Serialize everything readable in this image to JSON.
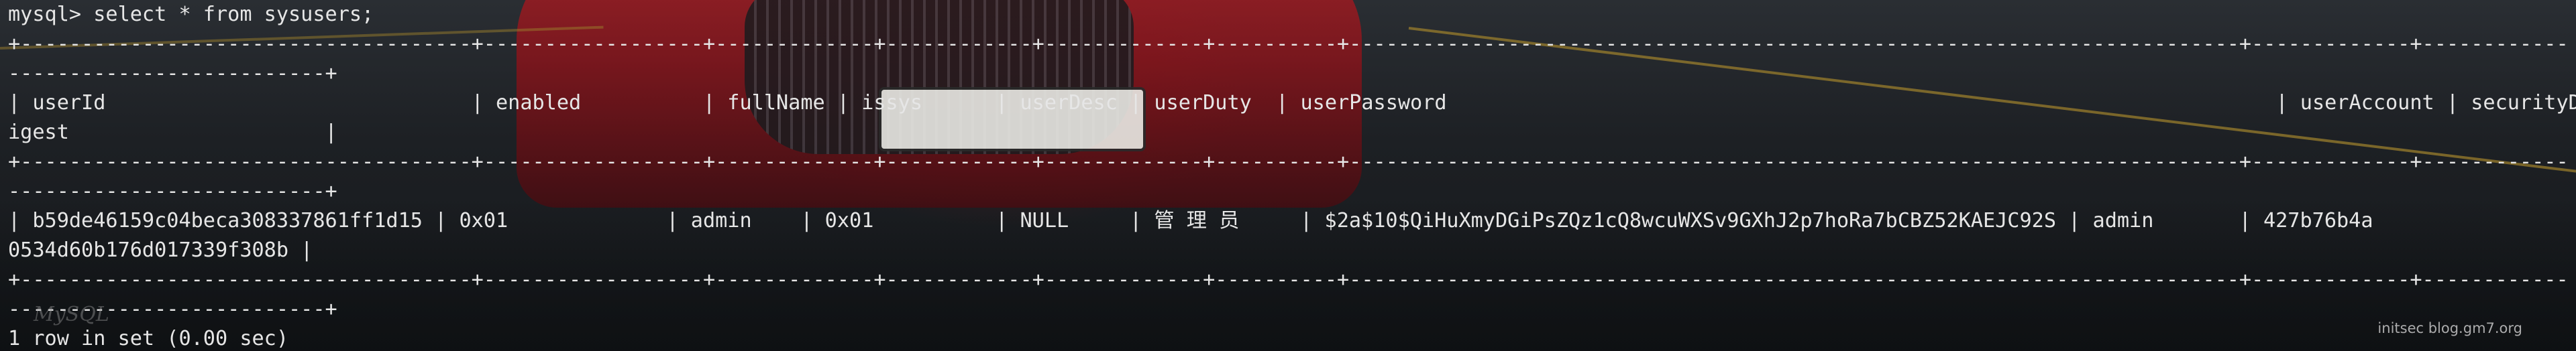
{
  "terminal": {
    "prompt": "mysql> select * from sysusers;",
    "border_1": "+-------------------------------------+------------------+-------------+------------+-------------+----------+-------------------------------------------------------------------------+-------------+------------",
    "border_2": "--------------------------+",
    "header_1": "| userId                              | enabled          | fullName | issys      | userDesc | userDuty  | userPassword                                                                    | userAccount | securityD",
    "header_2": "igest                     |",
    "row_1": "| b59de46159c04beca308337861ff1d15 | 0x01             | admin    | 0x01          | NULL     | 管 理 员     | $2a$10$QiHuXmyDGiPsZQz1cQ8wcuWXSv9GXhJ2p7hoRa7bCBZ52KAEJC92S | admin       | 427b76b4a",
    "row_2": "0534d60b176d017339f308b |",
    "result": "1 row in set (0.00 sec)"
  },
  "watermarks": {
    "mysql": "MySQL",
    "site": "initsec blog.gm7.org"
  },
  "colors": {
    "terminal_text": "#e6e6e6",
    "car_red": "#b81d24",
    "background": "#1b1e22"
  }
}
